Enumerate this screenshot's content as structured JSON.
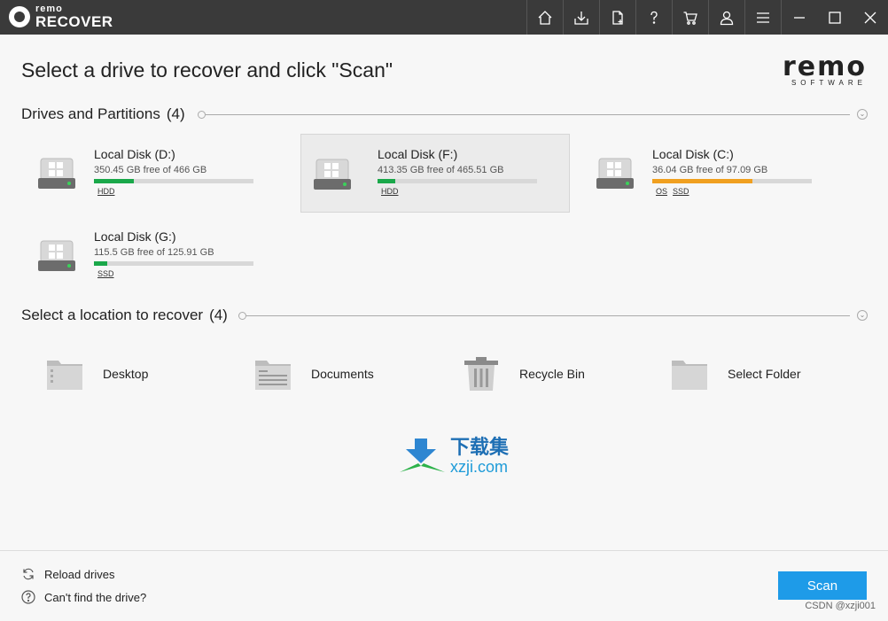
{
  "app": {
    "logo_small": "remo",
    "logo_big": "RECOVER",
    "brand_word": "remo",
    "brand_sub": "SOFTWARE"
  },
  "toolbar_icons": [
    "home-icon",
    "download-icon",
    "file-add-icon",
    "help-icon",
    "cart-icon",
    "user-icon",
    "menu-icon"
  ],
  "window_controls": [
    "minimize-icon",
    "maximize-icon",
    "close-icon"
  ],
  "heading": "Select a drive to recover and click \"Scan\"",
  "drives_section": {
    "label": "Drives and Partitions",
    "count": "(4)"
  },
  "drives": [
    {
      "name": "Local Disk (D:)",
      "free": "350.45 GB free of 466 GB",
      "used_fraction": 0.248,
      "bar_color": "#1aa84a",
      "tags": [
        "HDD"
      ],
      "selected": false
    },
    {
      "name": "Local Disk (F:)",
      "free": "413.35 GB free of 465.51 GB",
      "used_fraction": 0.112,
      "bar_color": "#1aa84a",
      "tags": [
        "HDD"
      ],
      "selected": true
    },
    {
      "name": "Local Disk (C:)",
      "free": "36.04 GB free of 97.09 GB",
      "used_fraction": 0.629,
      "bar_color": "#f0a020",
      "tags": [
        "OS",
        "SSD"
      ],
      "selected": false
    },
    {
      "name": "Local Disk (G:)",
      "free": "115.5 GB free of 125.91 GB",
      "used_fraction": 0.083,
      "bar_color": "#1aa84a",
      "tags": [
        "SSD"
      ],
      "selected": false
    }
  ],
  "locations_section": {
    "label": "Select a location to recover",
    "count": "(4)"
  },
  "locations": [
    {
      "label": "Desktop",
      "icon": "desktop-folder-icon"
    },
    {
      "label": "Documents",
      "icon": "documents-folder-icon"
    },
    {
      "label": "Recycle Bin",
      "icon": "recycle-bin-icon"
    },
    {
      "label": "Select Folder",
      "icon": "select-folder-icon"
    }
  ],
  "watermark": {
    "cn": "下载集",
    "url": "xzji.com"
  },
  "footer": {
    "reload": "Reload drives",
    "cant_find": "Can't find the drive?",
    "scan": "Scan",
    "credit": "CSDN @xzji001"
  }
}
